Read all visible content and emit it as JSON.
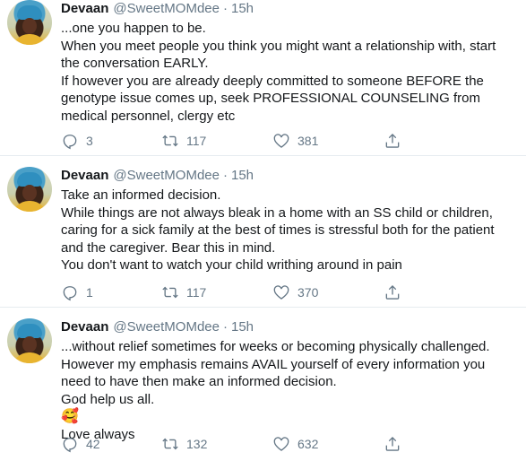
{
  "tweets": [
    {
      "author_name": "Devaan",
      "handle": "@SweetMOMdee",
      "separator": "·",
      "time": "15h",
      "lines": [
        "...one you happen to be.",
        "When you meet people you think you might want a relationship with, start the conversation EARLY.",
        "If however you are already deeply committed to someone BEFORE the genotype issue comes up, seek PROFESSIONAL  COUNSELING from medical personnel, clergy etc"
      ],
      "replies": "3",
      "retweets": "117",
      "likes": "381"
    },
    {
      "author_name": "Devaan",
      "handle": "@SweetMOMdee",
      "separator": "·",
      "time": "15h",
      "lines": [
        "Take an informed decision.",
        "While things are not always bleak in a home with an SS child or children, caring for a sick family at the best of times is stressful both for the patient and the caregiver. Bear this in mind.",
        "You don't want to watch your child writhing around in pain"
      ],
      "replies": "1",
      "retweets": "117",
      "likes": "370"
    },
    {
      "author_name": "Devaan",
      "handle": "@SweetMOMdee",
      "separator": "·",
      "time": "15h",
      "lines": [
        "...without relief sometimes for weeks or becoming physically challenged.",
        "However my emphasis remains AVAIL yourself of every information you need to have then make an informed decision.",
        "God help us all.",
        "🥰",
        "Love always"
      ],
      "replies": "42",
      "retweets": "132",
      "likes": "632"
    }
  ],
  "icons": {
    "reply": "reply-icon",
    "retweet": "retweet-icon",
    "like": "heart-icon",
    "share": "share-icon"
  },
  "colors": {
    "text": "#14171a",
    "secondary": "#657786",
    "divider": "#e6ecf0"
  }
}
